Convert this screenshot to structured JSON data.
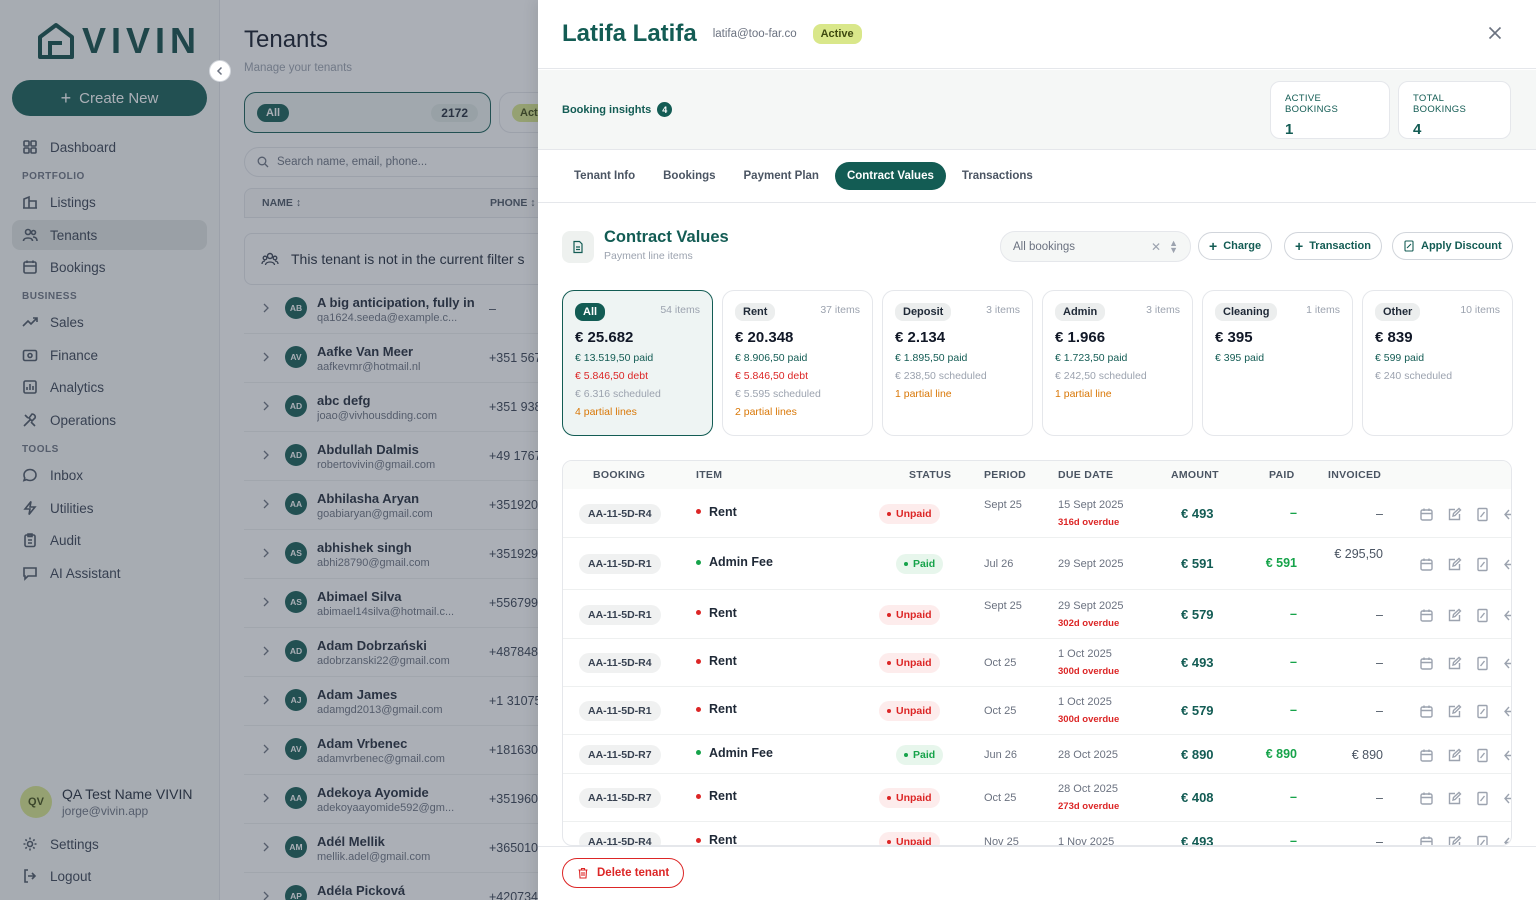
{
  "brand": {
    "name": "VIVIN"
  },
  "sidebar": {
    "create_label": "Create New",
    "sections": {
      "portfolio": "PORTFOLIO",
      "business": "BUSINESS",
      "tools": "TOOLS"
    },
    "items": {
      "dashboard": "Dashboard",
      "listings": "Listings",
      "tenants": "Tenants",
      "bookings": "Bookings",
      "sales": "Sales",
      "finance": "Finance",
      "analytics": "Analytics",
      "operations": "Operations",
      "inbox": "Inbox",
      "utilities": "Utilities",
      "audit": "Audit",
      "ai": "AI Assistant"
    },
    "user": {
      "initials": "QV",
      "name": "QA Test Name VIVIN",
      "email": "jorge@vivin.app"
    },
    "settings": "Settings",
    "logout": "Logout"
  },
  "tenants_page": {
    "title": "Tenants",
    "subtitle": "Manage your tenants",
    "filter_all": {
      "label": "All",
      "count": "2172"
    },
    "filter_active": {
      "label": "Act"
    },
    "search_placeholder": "Search name, email, phone...",
    "columns": {
      "name": "NAME",
      "phone": "PHONE"
    },
    "notice": "This tenant is not in the current filter s",
    "rows": [
      {
        "initials": "AB",
        "name": "A big anticipation, fully in",
        "email": "qa1624.seeda@example.c...",
        "phone": "–"
      },
      {
        "initials": "AV",
        "name": "Aafke Van Meer",
        "email": "aafkevmr@hotmail.nl",
        "phone": "+351 567"
      },
      {
        "initials": "AD",
        "name": "abc defg",
        "email": "joao@vivhousdding.com",
        "phone": "+351 938"
      },
      {
        "initials": "AD",
        "name": "Abdullah Dalmis",
        "email": "robertovivin@gmail.com",
        "phone": "+49 1767"
      },
      {
        "initials": "AA",
        "name": "Abhilasha Aryan",
        "email": "goabiaryan@gmail.com",
        "phone": "+351920"
      },
      {
        "initials": "AS",
        "name": "abhishek singh",
        "email": "abhi28790@gmail.com",
        "phone": "+351929"
      },
      {
        "initials": "AS",
        "name": "Abimael Silva",
        "email": "abimael14silva@hotmail.c...",
        "phone": "+556799"
      },
      {
        "initials": "AD",
        "name": "Adam Dobrzański",
        "email": "adobrzanski22@gmail.com",
        "phone": "+487848"
      },
      {
        "initials": "AJ",
        "name": "Adam James",
        "email": "adamgd2013@gmail.com",
        "phone": "+1 31075"
      },
      {
        "initials": "AV",
        "name": "Adam Vrbenec",
        "email": "adamvrbenec@gmail.com",
        "phone": "+181630"
      },
      {
        "initials": "AA",
        "name": "Adekoya Ayomide",
        "email": "adekoyaayomide592@gm...",
        "phone": "+351960"
      },
      {
        "initials": "AM",
        "name": "Adél Mellik",
        "email": "mellik.adel@gmail.com",
        "phone": "+365010"
      },
      {
        "initials": "AP",
        "name": "Adéla Picková",
        "email": "",
        "phone": "+420734"
      }
    ]
  },
  "drawer": {
    "name": "Latifa Latifa",
    "email": "latifa@too-far.co",
    "status": "Active",
    "insights_label": "Booking insights",
    "insights_count": "4",
    "stats": [
      {
        "label": "ACTIVE BOOKINGS",
        "value": "1"
      },
      {
        "label": "TOTAL BOOKINGS",
        "value": "4"
      }
    ],
    "tabs": [
      "Tenant Info",
      "Bookings",
      "Payment Plan",
      "Contract Values",
      "Transactions"
    ],
    "active_tab": "Contract Values",
    "section_title": "Contract Values",
    "section_sub": "Payment line items",
    "booking_select": "All bookings",
    "actions": {
      "charge": "Charge",
      "transaction": "Transaction",
      "discount": "Apply Discount"
    },
    "cards": [
      {
        "tag": "All",
        "count": "54 items",
        "amount": "€ 25.682",
        "lines": [
          {
            "t": "€ 13.519,50 paid",
            "k": "paid"
          },
          {
            "t": "€ 5.846,50 debt",
            "k": "debt"
          },
          {
            "t": "€ 6.316 scheduled",
            "k": "sched"
          },
          {
            "t": "4 partial lines",
            "k": "part"
          }
        ]
      },
      {
        "tag": "Rent",
        "count": "37 items",
        "amount": "€ 20.348",
        "lines": [
          {
            "t": "€ 8.906,50 paid",
            "k": "paid"
          },
          {
            "t": "€ 5.846,50 debt",
            "k": "debt"
          },
          {
            "t": "€ 5.595 scheduled",
            "k": "sched"
          },
          {
            "t": "2 partial lines",
            "k": "part"
          }
        ]
      },
      {
        "tag": "Deposit",
        "count": "3 items",
        "amount": "€ 2.134",
        "lines": [
          {
            "t": "€ 1.895,50 paid",
            "k": "paid"
          },
          {
            "t": "€ 238,50 scheduled",
            "k": "sched"
          },
          {
            "t": "1 partial line",
            "k": "part"
          }
        ]
      },
      {
        "tag": "Admin",
        "count": "3 items",
        "amount": "€ 1.966",
        "lines": [
          {
            "t": "€ 1.723,50 paid",
            "k": "paid"
          },
          {
            "t": "€ 242,50 scheduled",
            "k": "sched"
          },
          {
            "t": "1 partial line",
            "k": "part"
          }
        ]
      },
      {
        "tag": "Cleaning",
        "count": "1 items",
        "amount": "€ 395",
        "lines": [
          {
            "t": "€ 395 paid",
            "k": "paid"
          }
        ]
      },
      {
        "tag": "Other",
        "count": "10 items",
        "amount": "€ 839",
        "lines": [
          {
            "t": "€ 599 paid",
            "k": "paid"
          },
          {
            "t": "€ 240 scheduled",
            "k": "sched"
          }
        ]
      }
    ],
    "table": {
      "headers": {
        "booking": "BOOKING",
        "item": "ITEM",
        "status": "STATUS",
        "period": "PERIOD",
        "due": "DUE DATE",
        "amount": "AMOUNT",
        "paid": "PAID",
        "invoiced": "INVOICED"
      },
      "rows": [
        {
          "booking": "AA-11-5D-R4",
          "item": "Rent",
          "status": "Unpaid",
          "period": "Sept 25",
          "due": "15 Sept 2025",
          "overdue": "316d overdue",
          "amount": "€ 493",
          "paid": "–",
          "invoiced": "–"
        },
        {
          "booking": "AA-11-5D-R1",
          "item": "Admin Fee",
          "status": "Paid",
          "period": "Jul 26",
          "due": "29 Sept 2025",
          "overdue": "",
          "amount": "€ 591",
          "paid": "€ 591",
          "invoiced": "€ 295,50"
        },
        {
          "booking": "AA-11-5D-R1",
          "item": "Rent",
          "status": "Unpaid",
          "period": "Sept 25",
          "due": "29 Sept 2025",
          "overdue": "302d overdue",
          "amount": "€ 579",
          "paid": "–",
          "invoiced": "–"
        },
        {
          "booking": "AA-11-5D-R4",
          "item": "Rent",
          "status": "Unpaid",
          "period": "Oct 25",
          "due": "1 Oct 2025",
          "overdue": "300d overdue",
          "amount": "€ 493",
          "paid": "–",
          "invoiced": "–"
        },
        {
          "booking": "AA-11-5D-R1",
          "item": "Rent",
          "status": "Unpaid",
          "period": "Oct 25",
          "due": "1 Oct 2025",
          "overdue": "300d overdue",
          "amount": "€ 579",
          "paid": "–",
          "invoiced": "–"
        },
        {
          "booking": "AA-11-5D-R7",
          "item": "Admin Fee",
          "status": "Paid",
          "period": "Jun 26",
          "due": "28 Oct 2025",
          "overdue": "",
          "amount": "€ 890",
          "paid": "€ 890",
          "invoiced": "€ 890"
        },
        {
          "booking": "AA-11-5D-R7",
          "item": "Rent",
          "status": "Unpaid",
          "period": "Oct 25",
          "due": "28 Oct 2025",
          "overdue": "273d overdue",
          "amount": "€ 408",
          "paid": "–",
          "invoiced": "–"
        },
        {
          "booking": "AA-11-5D-R4",
          "item": "Rent",
          "status": "Unpaid",
          "period": "Nov 25",
          "due": "1 Nov 2025",
          "overdue": "",
          "amount": "€ 493",
          "paid": "–",
          "invoiced": "–"
        }
      ]
    },
    "delete_label": "Delete tenant"
  },
  "colors": {
    "brand": "#135c54",
    "lime": "#d9e78a",
    "debt": "#dc2626",
    "paid": "#16a34a",
    "partial": "#d97706"
  }
}
